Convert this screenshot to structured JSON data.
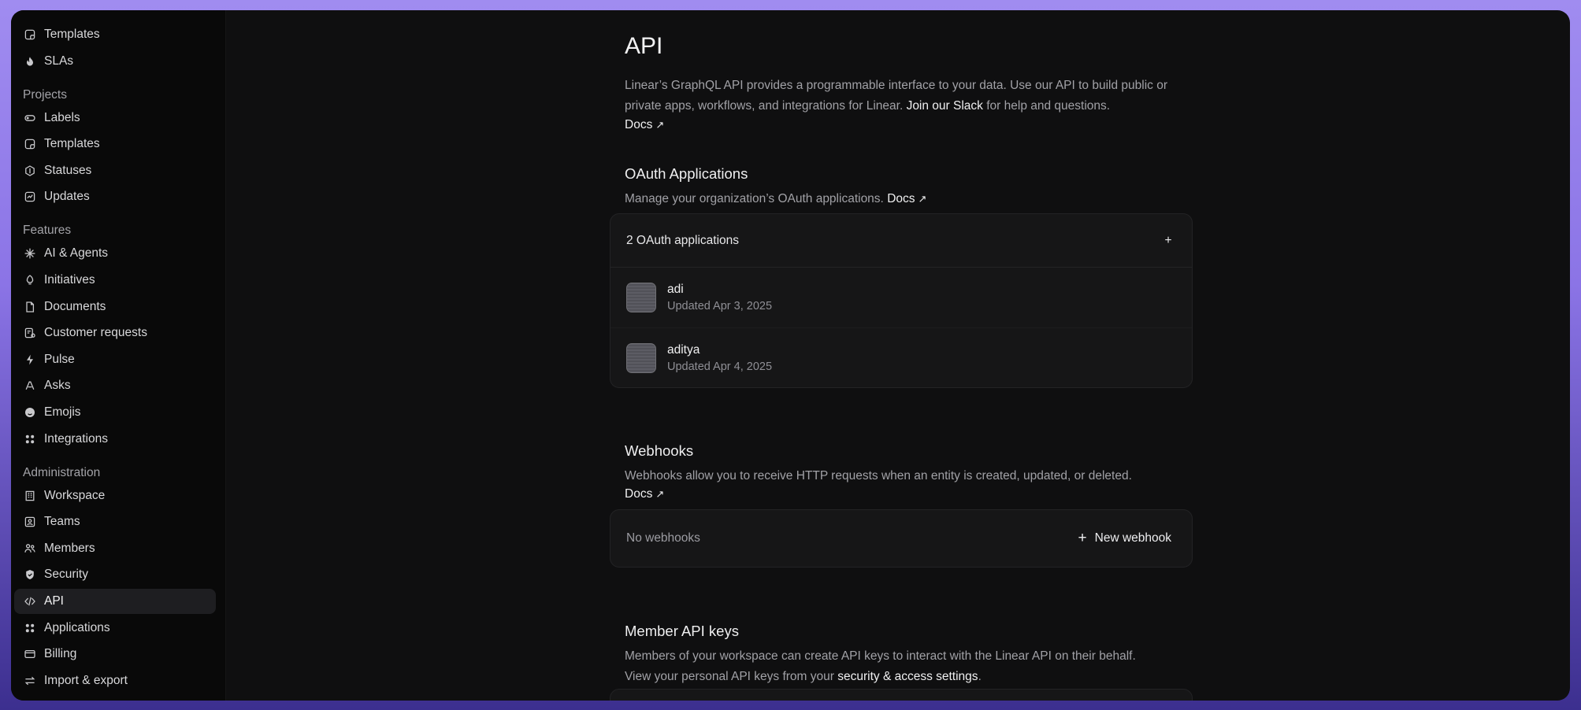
{
  "sidebar": {
    "top_items": [
      {
        "label": "Templates",
        "icon": "template-icon"
      },
      {
        "label": "SLAs",
        "icon": "flame-icon"
      }
    ],
    "sections": [
      {
        "title": "Projects",
        "items": [
          {
            "label": "Labels",
            "icon": "tag-icon"
          },
          {
            "label": "Templates",
            "icon": "template-icon"
          },
          {
            "label": "Statuses",
            "icon": "status-icon"
          },
          {
            "label": "Updates",
            "icon": "chart-icon"
          }
        ]
      },
      {
        "title": "Features",
        "items": [
          {
            "label": "AI & Agents",
            "icon": "sparkle-icon"
          },
          {
            "label": "Initiatives",
            "icon": "rocket-icon"
          },
          {
            "label": "Documents",
            "icon": "document-icon"
          },
          {
            "label": "Customer requests",
            "icon": "customer-icon"
          },
          {
            "label": "Pulse",
            "icon": "pulse-icon"
          },
          {
            "label": "Asks",
            "icon": "asks-icon"
          },
          {
            "label": "Emojis",
            "icon": "emoji-icon"
          },
          {
            "label": "Integrations",
            "icon": "grid-icon"
          }
        ]
      },
      {
        "title": "Administration",
        "items": [
          {
            "label": "Workspace",
            "icon": "building-icon"
          },
          {
            "label": "Teams",
            "icon": "team-icon"
          },
          {
            "label": "Members",
            "icon": "members-icon"
          },
          {
            "label": "Security",
            "icon": "shield-icon"
          },
          {
            "label": "API",
            "icon": "code-icon",
            "active": true
          },
          {
            "label": "Applications",
            "icon": "apps-icon"
          },
          {
            "label": "Billing",
            "icon": "card-icon"
          },
          {
            "label": "Import & export",
            "icon": "import-export-icon"
          }
        ]
      }
    ]
  },
  "page": {
    "title": "API",
    "intro_text": "Linear’s GraphQL API provides a programmable interface to your data. Use our API to build public or private apps, workflows, and integrations for Linear.",
    "intro_link": "Join our Slack",
    "intro_suffix": "for help and questions.",
    "docs_label": "Docs",
    "arrow": "↗"
  },
  "oauth": {
    "title": "OAuth Applications",
    "description": "Manage your organization’s OAuth applications.",
    "docs_label": "Docs",
    "count_label": "2 OAuth applications",
    "add_symbol": "+",
    "apps": [
      {
        "name": "adi",
        "updated": "Updated Apr 3, 2025"
      },
      {
        "name": "aditya",
        "updated": "Updated Apr 4, 2025"
      }
    ]
  },
  "webhooks": {
    "title": "Webhooks",
    "description": "Webhooks allow you to receive HTTP requests when an entity is created, updated, or deleted.",
    "docs_label": "Docs",
    "empty_label": "No webhooks",
    "new_label": "New webhook",
    "new_symbol": "+"
  },
  "member_keys": {
    "title": "Member API keys",
    "description": "Members of your workspace can create API keys to interact with the Linear API on their behalf.",
    "line2_prefix": "View your personal API keys from your",
    "line2_link": "security & access settings",
    "line2_suffix": "."
  },
  "colors": {
    "background": "#0f0f10",
    "sidebar": "#090909",
    "accent_frame": "#9f8cf0"
  }
}
